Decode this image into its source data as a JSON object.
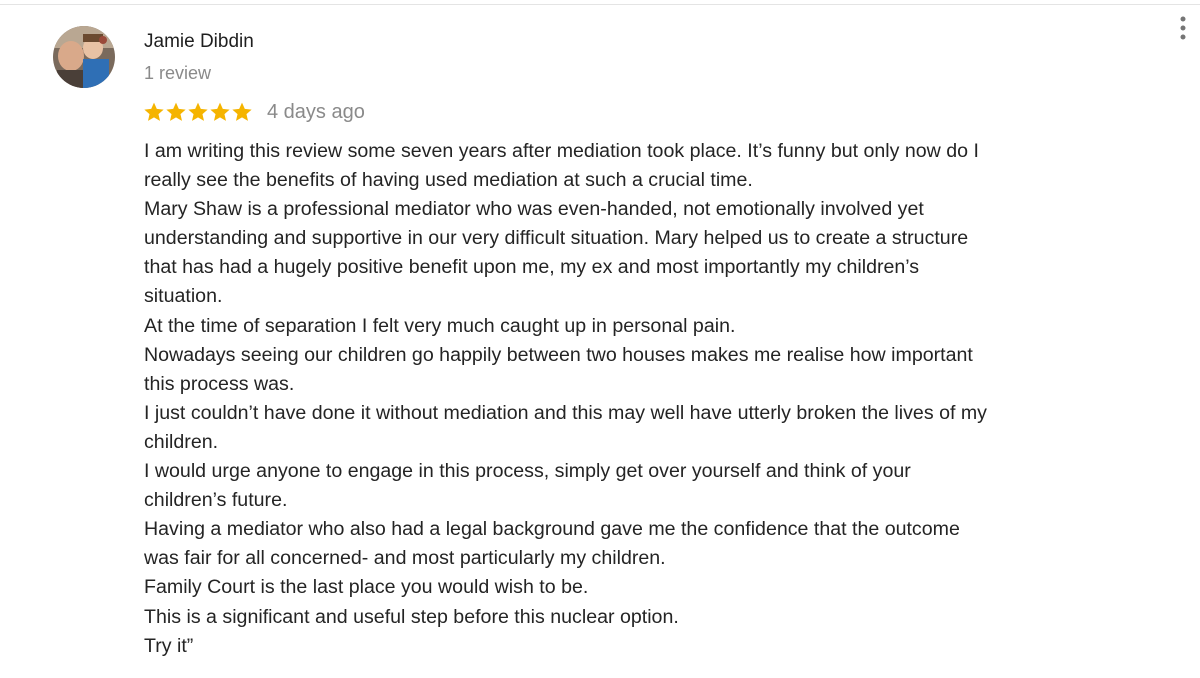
{
  "review": {
    "reviewer_name": "Jamie Dibdin",
    "review_count": "1 review",
    "rating": 5,
    "rating_max": 5,
    "date": "4 days ago",
    "star_color": "#f5b400",
    "lines": [
      "I am writing this review some seven years after mediation took place. It’s funny but only now do I",
      "really see the benefits of having used mediation at such a crucial time.",
      "Mary Shaw is a  professional mediator who was even-handed, not emotionally involved yet",
      "understanding and supportive in our very difficult situation. Mary helped us to create a structure",
      "that has had a hugely positive benefit upon me, my ex and most importantly my children’s",
      "situation.",
      "At the time of separation I felt very much caught up in personal pain.",
      "Nowadays seeing our children go happily between two houses makes me realise how important",
      "this process was.",
      "I just couldn’t have done it without mediation and this may well have utterly broken the lives of my",
      "children.",
      "I would urge anyone to engage in this process, simply get over yourself and think of your",
      "children’s future.",
      "Having a mediator who also had a legal background gave me the confidence that the outcome",
      "was fair for all concerned- and most particularly my children.",
      "Family Court is the last place you would wish to be.",
      "This is a significant and useful step before this nuclear option.",
      "Try it”"
    ]
  },
  "icons": {
    "avatar": "reviewer-avatar-photo",
    "star": "star-icon",
    "menu": "more-vert-icon"
  }
}
